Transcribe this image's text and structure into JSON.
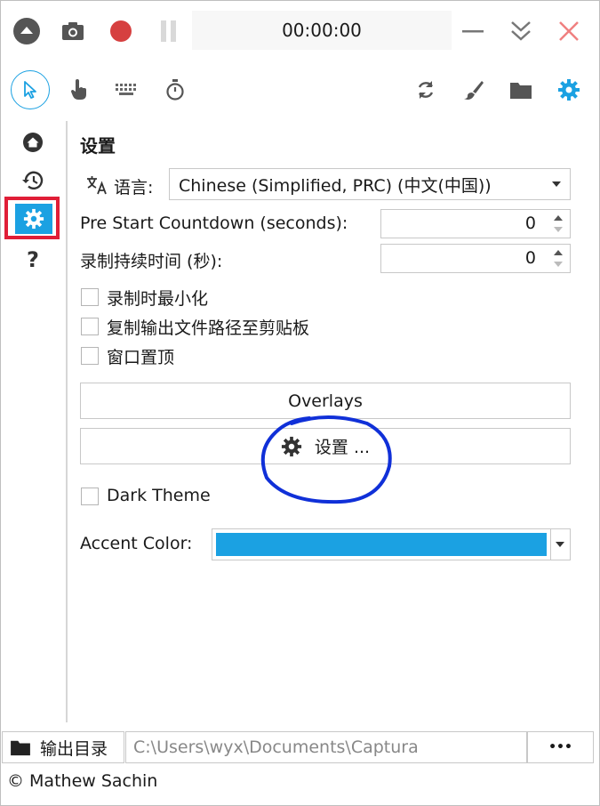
{
  "toolbar": {
    "timer": "00:00:00",
    "icons": [
      "collapse-icon",
      "camera-icon",
      "record-icon",
      "pause-icon",
      "minimize-icon",
      "chevrons-down-icon",
      "close-icon"
    ]
  },
  "modes": {
    "icons": [
      "pointer-icon",
      "hand-icon",
      "keyboard-icon",
      "stopwatch-icon",
      "refresh-icon",
      "brush-icon",
      "folder-icon",
      "gear-icon"
    ]
  },
  "sidebar": {
    "items": [
      "home-icon",
      "history-icon",
      "gear-icon",
      "help-icon"
    ],
    "help_glyph": "?"
  },
  "settings": {
    "title": "设置",
    "language_label": "语言:",
    "language_value": "Chinese (Simplified, PRC) (中文(中国))",
    "countdown_label": "Pre Start Countdown (seconds):",
    "countdown_value": "0",
    "duration_label": "录制持续时间 (秒):",
    "duration_value": "0",
    "checkboxes": [
      "录制时最小化",
      "复制输出文件路径至剪贴板",
      "窗口置顶"
    ],
    "overlays_label": "Overlays",
    "settings_button_label": "设置 ...",
    "dark_theme_label": "Dark Theme",
    "accent_label": "Accent Color:",
    "accent_color": "#1ba1e2"
  },
  "footer": {
    "output_dir_label": "输出目录",
    "output_path": "C:\\Users\\wyx\\Documents\\Captura",
    "more_label": "•••",
    "copyright": "© Mathew Sachin"
  },
  "colors": {
    "accent": "#1ba1e2",
    "record": "#d64040",
    "close": "#f08080",
    "annotation_red": "#e01e37",
    "annotation_blue": "#1030d8"
  }
}
